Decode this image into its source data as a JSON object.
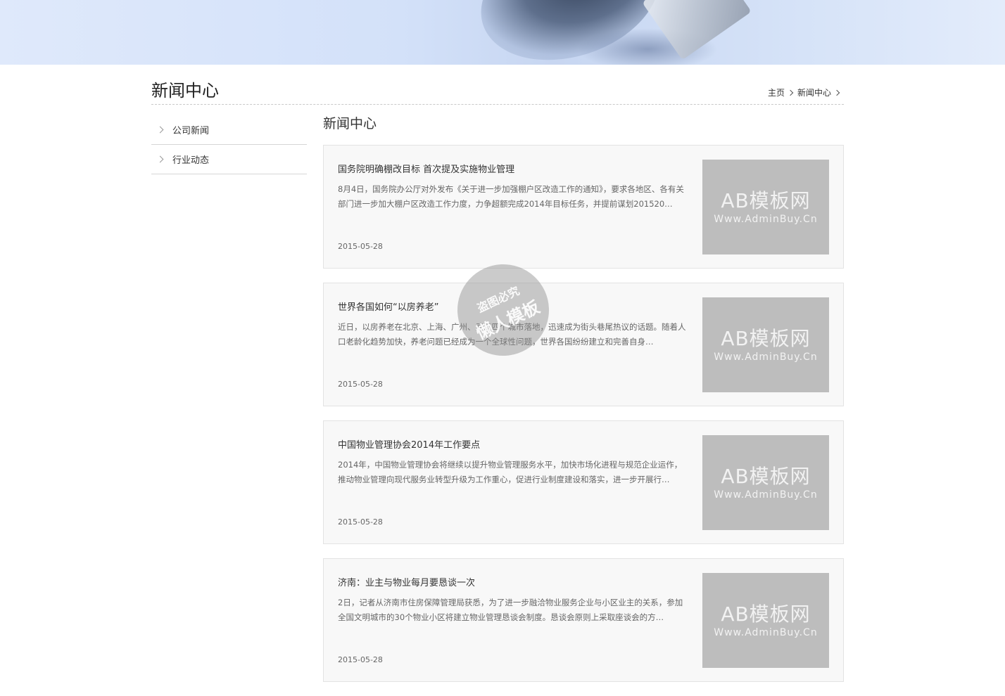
{
  "header": {
    "title": "新闻中心",
    "breadcrumb": [
      "主页",
      "新闻中心"
    ]
  },
  "sidebar": {
    "items": [
      {
        "label": "公司新闻"
      },
      {
        "label": "行业动态"
      }
    ]
  },
  "main": {
    "section_title": "新闻中心",
    "news": [
      {
        "title": "国务院明确棚改目标 首次提及实施物业管理",
        "summary": "8月4日，国务院办公厅对外发布《关于进一步加强棚户区改造工作的通知》，要求各地区、各有关部门进一步加大棚户区改造工作力度，力争超额完成2014年目标任务，并提前谋划201520…",
        "date": "2015-05-28",
        "thumb_line1": "AB模板网",
        "thumb_line2": "Www.AdminBuy.Cn"
      },
      {
        "title": "世界各国如何“以房养老”",
        "summary": "近日，以房养老在北京、上海、广州、武汉四个城市落地，迅速成为街头巷尾热议的话题。随着人口老龄化趋势加快，养老问题已经成为一个全球性问题，世界各国纷纷建立和完善自身…",
        "date": "2015-05-28",
        "thumb_line1": "AB模板网",
        "thumb_line2": "Www.AdminBuy.Cn"
      },
      {
        "title": "中国物业管理协会2014年工作要点",
        "summary": "2014年，中国物业管理协会将继续以提升物业管理服务水平，加快市场化进程与规范企业运作，推动物业管理向现代服务业转型升级为工作重心，促进行业制度建设和落实，进一步开展行…",
        "date": "2015-05-28",
        "thumb_line1": "AB模板网",
        "thumb_line2": "Www.AdminBuy.Cn"
      },
      {
        "title": "济南：业主与物业每月要恳谈一次",
        "summary": "2日，记者从济南市住房保障管理局获悉，为了进一步融洽物业服务企业与小区业主的关系，参加全国文明城市的30个物业小区将建立物业管理恳谈会制度。恳谈会原则上采取座谈会的方…",
        "date": "2015-05-28",
        "thumb_line1": "AB模板网",
        "thumb_line2": "Www.AdminBuy.Cn"
      }
    ]
  },
  "watermark": {
    "line1": "盗图必究",
    "line2": "懒人模板"
  }
}
